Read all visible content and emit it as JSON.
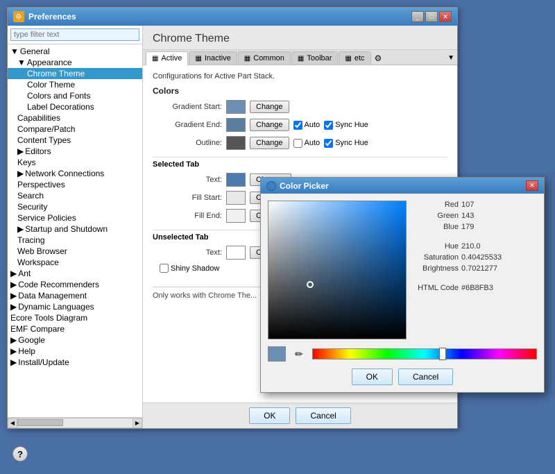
{
  "preferences": {
    "title": "Preferences",
    "filter_placeholder": "type filter text"
  },
  "tree": {
    "items": [
      {
        "id": "general",
        "label": "General",
        "level": 0,
        "arrow": "▼",
        "icon": "📁"
      },
      {
        "id": "appearance",
        "label": "Appearance",
        "level": 1,
        "arrow": "▼",
        "icon": "📁",
        "selected": false
      },
      {
        "id": "chrome-theme",
        "label": "Chrome Theme",
        "level": 2,
        "arrow": "",
        "icon": "",
        "selected": true
      },
      {
        "id": "color-theme",
        "label": "Color Theme",
        "level": 2,
        "arrow": "",
        "icon": ""
      },
      {
        "id": "colors-fonts",
        "label": "Colors and Fonts",
        "level": 2,
        "arrow": "",
        "icon": ""
      },
      {
        "id": "label-decorations",
        "label": "Label Decorations",
        "level": 2,
        "arrow": "",
        "icon": ""
      },
      {
        "id": "capabilities",
        "label": "Capabilities",
        "level": 1,
        "arrow": "",
        "icon": ""
      },
      {
        "id": "compare-patch",
        "label": "Compare/Patch",
        "level": 1,
        "arrow": "",
        "icon": ""
      },
      {
        "id": "content-types",
        "label": "Content Types",
        "level": 1,
        "arrow": "",
        "icon": ""
      },
      {
        "id": "editors",
        "label": "Editors",
        "level": 1,
        "arrow": "▶",
        "icon": ""
      },
      {
        "id": "keys",
        "label": "Keys",
        "level": 1,
        "arrow": "",
        "icon": ""
      },
      {
        "id": "network-connections",
        "label": "Network Connections",
        "level": 1,
        "arrow": "▶",
        "icon": ""
      },
      {
        "id": "perspectives",
        "label": "Perspectives",
        "level": 1,
        "arrow": "",
        "icon": ""
      },
      {
        "id": "search",
        "label": "Search",
        "level": 1,
        "arrow": "",
        "icon": ""
      },
      {
        "id": "security",
        "label": "Security",
        "level": 1,
        "arrow": "",
        "icon": ""
      },
      {
        "id": "service-policies",
        "label": "Service Policies",
        "level": 1,
        "arrow": "",
        "icon": ""
      },
      {
        "id": "startup-shutdown",
        "label": "Startup and Shutdown",
        "level": 1,
        "arrow": "▶",
        "icon": ""
      },
      {
        "id": "tracing",
        "label": "Tracing",
        "level": 1,
        "arrow": "",
        "icon": ""
      },
      {
        "id": "web-browser",
        "label": "Web Browser",
        "level": 1,
        "arrow": "",
        "icon": ""
      },
      {
        "id": "workspace",
        "label": "Workspace",
        "level": 1,
        "arrow": "",
        "icon": ""
      },
      {
        "id": "ant",
        "label": "Ant",
        "level": 0,
        "arrow": "▶",
        "icon": ""
      },
      {
        "id": "code-recommenders",
        "label": "Code Recommenders",
        "level": 0,
        "arrow": "▶",
        "icon": ""
      },
      {
        "id": "data-management",
        "label": "Data Management",
        "level": 0,
        "arrow": "▶",
        "icon": ""
      },
      {
        "id": "dynamic-languages",
        "label": "Dynamic Languages",
        "level": 0,
        "arrow": "▶",
        "icon": ""
      },
      {
        "id": "ecore-tools",
        "label": "Ecore Tools Diagram",
        "level": 0,
        "arrow": "",
        "icon": ""
      },
      {
        "id": "emf-compare",
        "label": "EMF Compare",
        "level": 0,
        "arrow": "",
        "icon": ""
      },
      {
        "id": "google",
        "label": "Google",
        "level": 0,
        "arrow": "▶",
        "icon": ""
      },
      {
        "id": "help",
        "label": "Help",
        "level": 0,
        "arrow": "▶",
        "icon": ""
      },
      {
        "id": "install-update",
        "label": "Install/Update",
        "level": 0,
        "arrow": "▶",
        "icon": ""
      }
    ]
  },
  "right_panel": {
    "title": "Chrome Theme",
    "tabs": [
      {
        "id": "active",
        "label": "Active",
        "icon": "▦",
        "active": true
      },
      {
        "id": "inactive",
        "label": "Inactive",
        "icon": "▦"
      },
      {
        "id": "common",
        "label": "Common",
        "icon": "▦"
      },
      {
        "id": "toolbar",
        "label": "Toolbar",
        "icon": "▦"
      },
      {
        "id": "etc",
        "label": "etc",
        "icon": "▦"
      }
    ],
    "config_desc": "Configurations for Active Part Stack.",
    "colors_section": "Colors",
    "gradient_start_label": "Gradient Start:",
    "gradient_end_label": "Gradient End:",
    "outline_label": "Outline:",
    "change_btn": "Change",
    "auto_label": "Auto",
    "sync_hue_label": "Sync Hue",
    "selected_tab_section": "Selected Tab",
    "text_label": "Text:",
    "fill_start_label": "Fill Start:",
    "fill_end_label": "Fill End:",
    "unselected_tab_section": "Unselected Tab",
    "shiny_shadow_label": "Shiny Shadow",
    "footer_note": "Only works with Chrome The...",
    "ok_label": "OK",
    "cancel_label": "Cancel"
  },
  "color_picker": {
    "title": "Color Picker",
    "red_label": "Red",
    "green_label": "Green",
    "blue_label": "Blue",
    "hue_label": "Hue",
    "saturation_label": "Saturation",
    "brightness_label": "Brightness",
    "html_code_label": "HTML Code",
    "red_value": "107",
    "green_value": "143",
    "blue_value": "179",
    "hue_value": "210.0",
    "saturation_value": "0.40425533",
    "brightness_value": "0.7021277",
    "html_code_value": "#6B8FB3",
    "ok_label": "OK",
    "cancel_label": "Cancel"
  },
  "help_label": "?",
  "bottom_ok": "OK",
  "bottom_cancel": "Cancel"
}
